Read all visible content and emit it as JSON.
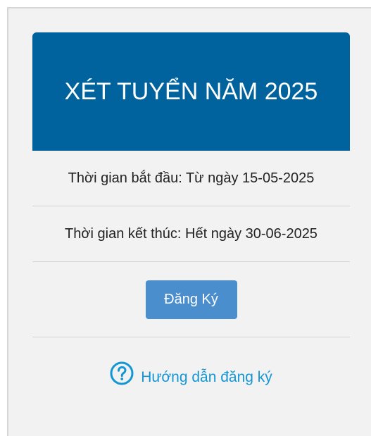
{
  "card": {
    "title": "XÉT TUYỂN NĂM 2025",
    "start_time": "Thời gian bắt đầu: Từ ngày 15-05-2025",
    "end_time": "Thời gian kết thúc: Hết ngày 30-06-2025",
    "register_label": "Đăng Ký",
    "guide_label": "Hướng dẫn đăng ký",
    "guide_icon": "help-circle-icon"
  },
  "colors": {
    "header_bg": "#01639d",
    "button_bg": "#4a8ece",
    "link": "#1596d4",
    "panel_bg": "#f2f2f2"
  }
}
